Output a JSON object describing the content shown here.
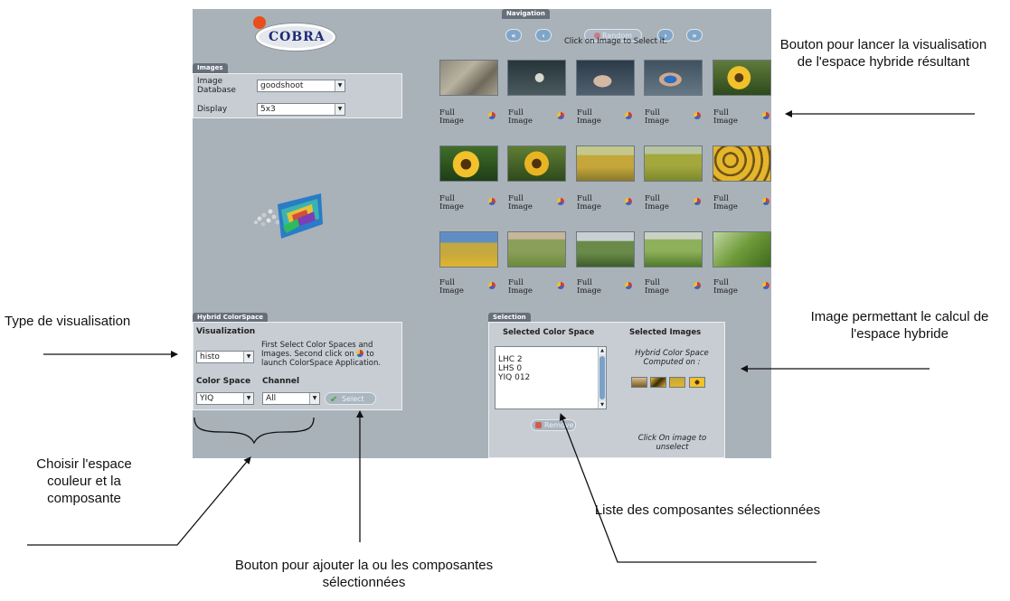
{
  "app": {
    "logo_text": "COBRA",
    "navigation": {
      "tab": "Navigation",
      "first_label": "«",
      "prev_label": "‹",
      "random_label": "Random",
      "next_label": "›",
      "last_label": "»",
      "hint": "Click on Image to Select it."
    },
    "images_panel": {
      "tab": "Images",
      "database_label": "Image Database",
      "database_value": "goodshoot",
      "display_label": "Display",
      "display_value": "5x3"
    },
    "thumbnails": {
      "label": "Full Image",
      "icon": "color-wheel-icon"
    },
    "hybrid_panel": {
      "tab": "Hybrid ColorSpace",
      "visualization_label": "Visualization",
      "visualization_value": "histo",
      "instructions": "First Select Color Spaces and Images. Second click on",
      "instructions_end": "to launch ColorSpace Application.",
      "colorspace_label": "Color Space",
      "colorspace_value": "YIQ",
      "channel_label": "Channel",
      "channel_value": "All",
      "select_button": "Select"
    },
    "selection_panel": {
      "tab": "Selection",
      "color_space_header": "Selected Color Space",
      "images_header": "Selected Images",
      "items": [
        "LHC 2",
        "LHS 0",
        "YIQ 012"
      ],
      "hybrid_note": "Hybrid Color Space Computed on :",
      "remove_button": "Remove",
      "unselect_hint": "Click On image to unselect"
    }
  },
  "annotations": {
    "launch_button": "Bouton pour lancer la visualisation de l'espace hybride résultant",
    "viz_type": "Type de visualisation",
    "choose_space": "Choisir l'espace couleur et la composante",
    "add_button": "Bouton pour ajouter la ou les composantes sélectionnées",
    "list_components": "Liste des composantes sélectionnées",
    "image_calc": "Image permettant le calcul de l'espace hybride"
  },
  "colors": {
    "app_bg": "#a9b1b9",
    "panel_bg": "#c7cdd3",
    "tab_bg": "#67707a",
    "nav_button": "#7fa6c8"
  }
}
